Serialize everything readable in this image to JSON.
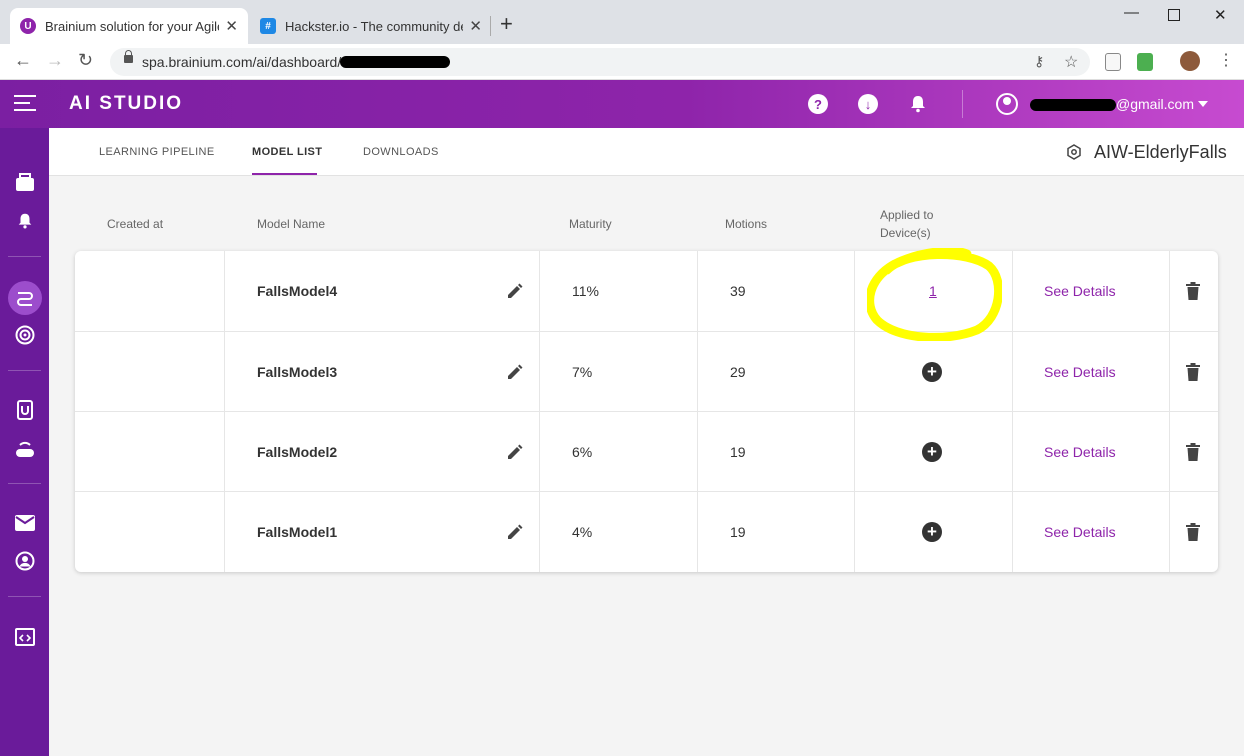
{
  "browser": {
    "tabs": [
      {
        "title": "Brainium solution for your Agile",
        "favicon": "brainium-favicon",
        "active": true
      },
      {
        "title": "Hackster.io - The community ded",
        "favicon": "hackster-favicon",
        "active": false
      }
    ],
    "url": "spa.brainium.com/ai/dashboard/"
  },
  "app": {
    "logo": "AI STUDIO",
    "user_email_suffix": "@gmail.com",
    "project_name": "AIW-ElderlyFalls"
  },
  "subnav": {
    "tabs": [
      "LEARNING PIPELINE",
      "MODEL LIST",
      "DOWNLOADS"
    ],
    "active": "MODEL LIST"
  },
  "table": {
    "headers": {
      "created_at": "Created at",
      "model_name": "Model Name",
      "maturity": "Maturity",
      "motions": "Motions",
      "applied": "Applied to\nDevice(s)"
    },
    "rows": [
      {
        "created_at": "",
        "model_name": "FallsModel4",
        "maturity": "11%",
        "motions": "39",
        "applied": "1",
        "details": "See Details"
      },
      {
        "created_at": "",
        "model_name": "FallsModel3",
        "maturity": "7%",
        "motions": "29",
        "applied": null,
        "details": "See Details"
      },
      {
        "created_at": "",
        "model_name": "FallsModel2",
        "maturity": "6%",
        "motions": "19",
        "applied": null,
        "details": "See Details"
      },
      {
        "created_at": "",
        "model_name": "FallsModel1",
        "maturity": "4%",
        "motions": "19",
        "applied": null,
        "details": "See Details"
      }
    ]
  },
  "colors": {
    "accent": "#8e24aa",
    "sidebar": "#6a1b9a",
    "highlight": "#ffff00"
  }
}
